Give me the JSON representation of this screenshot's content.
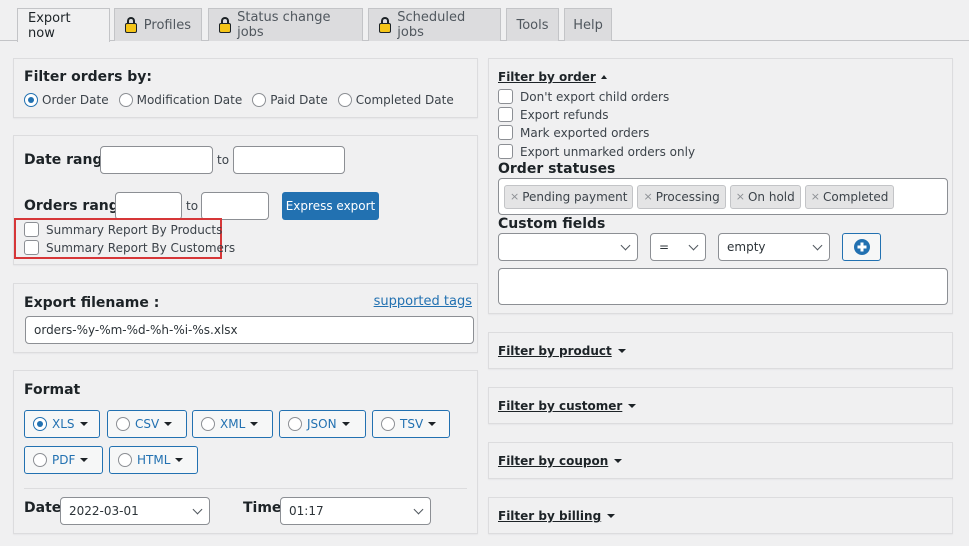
{
  "tabs": [
    {
      "label": "Export now",
      "locked": false,
      "active": true
    },
    {
      "label": "Profiles",
      "locked": true,
      "active": false
    },
    {
      "label": "Status change jobs",
      "locked": true,
      "active": false
    },
    {
      "label": "Scheduled jobs",
      "locked": true,
      "active": false
    },
    {
      "label": "Tools",
      "locked": false,
      "active": false
    },
    {
      "label": "Help",
      "locked": false,
      "active": false
    }
  ],
  "filter_orders_by": {
    "title": "Filter orders by:",
    "options": [
      "Order Date",
      "Modification Date",
      "Paid Date",
      "Completed Date"
    ],
    "selected": "Order Date"
  },
  "ranges": {
    "date_range_label": "Date range",
    "orders_range_label": "Orders range",
    "to_label": "to",
    "date_from": "",
    "date_to": "",
    "orders_from": "",
    "orders_to": "",
    "express_export_label": "Express export",
    "summary_products": "Summary Report By Products",
    "summary_customers": "Summary Report By Customers"
  },
  "export_filename": {
    "label": "Export filename :",
    "supported_tags_link": "supported tags",
    "value": "orders-%y-%m-%d-%h-%i-%s.xlsx"
  },
  "format": {
    "title": "Format",
    "options": [
      "XLS",
      "CSV",
      "XML",
      "JSON",
      "TSV",
      "PDF",
      "HTML"
    ],
    "selected": "XLS",
    "date_label": "Date",
    "date_value": "2022-03-01",
    "time_label": "Time",
    "time_value": "01:17"
  },
  "filter_by_order": {
    "title": "Filter by order",
    "checkboxes": [
      "Don't export child orders",
      "Export refunds",
      "Mark exported orders",
      "Export unmarked orders only"
    ],
    "order_statuses_label": "Order statuses",
    "statuses": [
      "Pending payment",
      "Processing",
      "On hold",
      "Completed"
    ],
    "custom_fields_label": "Custom fields",
    "custom_field_value": "",
    "operator": "=",
    "condition": "empty"
  },
  "collapsed_filters": [
    "Filter by product",
    "Filter by customer",
    "Filter by coupon",
    "Filter by billing"
  ],
  "colors": {
    "accent": "#2271b1",
    "highlight_border": "#d63638",
    "lock": "#f5c518"
  }
}
